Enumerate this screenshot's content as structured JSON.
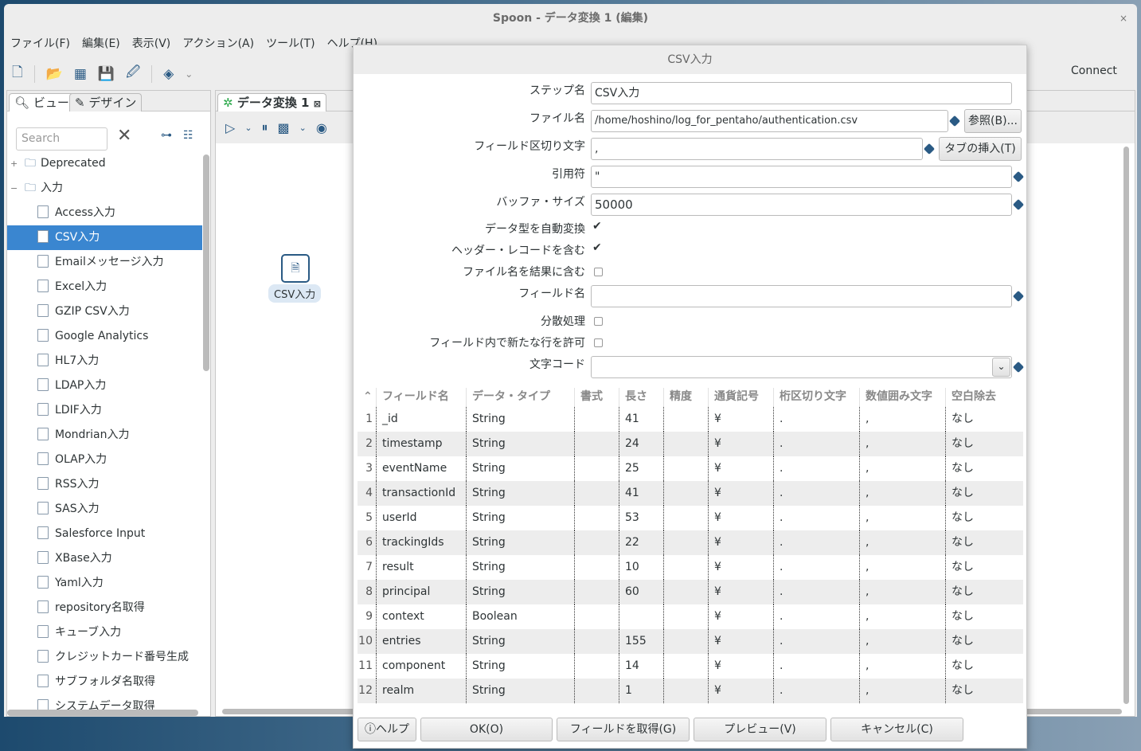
{
  "window": {
    "title": "Spoon - データ変換 1 (編集)",
    "close": "×"
  },
  "menu": [
    "ファイル(F)",
    "編集(E)",
    "表示(V)",
    "アクション(A)",
    "ツール(T)",
    "ヘルプ(H)"
  ],
  "toolbar": {
    "connect": "Connect"
  },
  "left": {
    "tabs": [
      "ビュー",
      "デザイン"
    ],
    "search_placeholder": "Search",
    "tree": [
      {
        "label": "Deprecated",
        "type": "folder",
        "exp": "+"
      },
      {
        "label": "入力",
        "type": "folder",
        "exp": "−"
      },
      {
        "label": "Access入力"
      },
      {
        "label": "CSV入力",
        "selected": true
      },
      {
        "label": "Emailメッセージ入力"
      },
      {
        "label": "Excel入力"
      },
      {
        "label": "GZIP CSV入力"
      },
      {
        "label": "Google Analytics"
      },
      {
        "label": "HL7入力"
      },
      {
        "label": "LDAP入力"
      },
      {
        "label": "LDIF入力"
      },
      {
        "label": "Mondrian入力"
      },
      {
        "label": "OLAP入力"
      },
      {
        "label": "RSS入力"
      },
      {
        "label": "SAS入力"
      },
      {
        "label": "Salesforce Input"
      },
      {
        "label": "XBase入力"
      },
      {
        "label": "Yaml入力"
      },
      {
        "label": "repository名取得"
      },
      {
        "label": "キューブ入力"
      },
      {
        "label": "クレジットカード番号生成"
      },
      {
        "label": "サブフォルダ名取得"
      },
      {
        "label": "システムデータ取得"
      }
    ]
  },
  "canvas": {
    "tab": "データ変換 1",
    "step_label": "CSV入力"
  },
  "dialog": {
    "title": "CSV入力",
    "fields": {
      "step_name_label": "ステップ名",
      "step_name": "CSV入力",
      "filename_label": "ファイル名",
      "filename": "/home/hoshino/log_for_pentaho/authentication.csv",
      "browse": "参照(B)...",
      "delimiter_label": "フィールド区切り文字",
      "delimiter": ",",
      "insert_tab": "タブの挿入(T)",
      "enclosure_label": "引用符",
      "enclosure": "\"",
      "buffer_label": "バッファ・サイズ",
      "buffer": "50000",
      "lazy_label": "データ型を自動変換",
      "header_label": "ヘッダー・レコードを含む",
      "addfile_label": "ファイル名を結果に含む",
      "fieldname_label": "フィールド名",
      "fieldname": "",
      "parallel_label": "分散処理",
      "newline_label": "フィールド内で新たな行を許可",
      "encoding_label": "文字コード",
      "encoding": ""
    },
    "checks": {
      "lazy": true,
      "header": true,
      "addfile": false,
      "parallel": false,
      "newline": false
    },
    "table": {
      "columns": [
        "フィールド名",
        "データ・タイプ",
        "書式",
        "長さ",
        "精度",
        "通貨記号",
        "桁区切り文字",
        "数値囲み文字",
        "空白除去"
      ],
      "rows": [
        [
          "_id",
          "String",
          "",
          "41",
          "",
          "¥",
          ".",
          ",",
          "なし"
        ],
        [
          "timestamp",
          "String",
          "",
          "24",
          "",
          "¥",
          ".",
          ",",
          "なし"
        ],
        [
          "eventName",
          "String",
          "",
          "25",
          "",
          "¥",
          ".",
          ",",
          "なし"
        ],
        [
          "transactionId",
          "String",
          "",
          "41",
          "",
          "¥",
          ".",
          ",",
          "なし"
        ],
        [
          "userId",
          "String",
          "",
          "53",
          "",
          "¥",
          ".",
          ",",
          "なし"
        ],
        [
          "trackingIds",
          "String",
          "",
          "22",
          "",
          "¥",
          ".",
          ",",
          "なし"
        ],
        [
          "result",
          "String",
          "",
          "10",
          "",
          "¥",
          ".",
          ",",
          "なし"
        ],
        [
          "principal",
          "String",
          "",
          "60",
          "",
          "¥",
          ".",
          ",",
          "なし"
        ],
        [
          "context",
          "Boolean",
          "",
          "",
          "",
          "¥",
          ".",
          ",",
          "なし"
        ],
        [
          "entries",
          "String",
          "",
          "155",
          "",
          "¥",
          ".",
          ",",
          "なし"
        ],
        [
          "component",
          "String",
          "",
          "14",
          "",
          "¥",
          ".",
          ",",
          "なし"
        ],
        [
          "realm",
          "String",
          "",
          "1",
          "",
          "¥",
          ".",
          ",",
          "なし"
        ]
      ]
    },
    "buttons": {
      "help": "ヘルプ",
      "ok": "OK(O)",
      "get_fields": "フィールドを取得(G)",
      "preview": "プレビュー(V)",
      "cancel": "キャンセル(C)"
    }
  }
}
